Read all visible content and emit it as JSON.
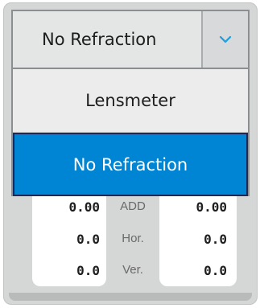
{
  "select": {
    "current_value": "No Refraction",
    "toggle_icon": "chevron-down-icon",
    "accent_color": "#1a9fe0"
  },
  "dropdown": {
    "options": [
      {
        "label": "Lensmeter",
        "selected": false
      },
      {
        "label": "No Refraction",
        "selected": true
      }
    ],
    "highlight_color": "#0084d4"
  },
  "measurements": {
    "rows": [
      {
        "left": "0.00",
        "label": "ADD",
        "right": "0.00"
      },
      {
        "left": "0.0",
        "label": "Hor.",
        "right": "0.0"
      },
      {
        "left": "0.0",
        "label": "Ver.",
        "right": "0.0"
      }
    ]
  }
}
